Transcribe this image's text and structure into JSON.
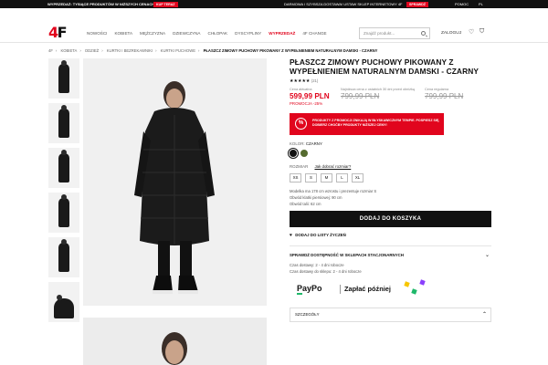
{
  "topbar": {
    "promo1": "WYPRZEDAŻ: TYSIĄCE PRODUKTÓW W NIŻSZYCH CENACH",
    "promo1_button": "KUP TERAZ",
    "promo2": "DARMOWA I SZYBSZA DOSTAWA! USTAW SKLEP INTERNETOWY 4F",
    "promo2_button": "SPRAWDŹ",
    "help": "POMOC",
    "lang": "PL"
  },
  "header": {
    "logo": "4F",
    "nav": [
      "NOWOŚCI",
      "KOBIETA",
      "MĘŻCZYZNA",
      "DZIEWCZYNA",
      "CHŁOPAK",
      "DYSCYPLINY",
      "WYPRZEDAŻ",
      "4F CHANGE"
    ],
    "search_placeholder": "Znajdź produkt...",
    "login": "ZALOGUJ"
  },
  "breadcrumb": [
    "4F",
    "KOBIETA",
    "ODZIEŻ",
    "KURTKI I BEZREKAWNIKI",
    "KURTKI PUCHOWE",
    "PŁASZCZ ZIMOWY PUCHOWY PIKOWANY Z WYPEŁNIENIEM NATURALNYM DAMSKI - CZARNY"
  ],
  "product": {
    "title": "PŁASZCZ ZIMOWY PUCHOWY PIKOWANY Z WYPEŁNIENIEM NATURALNYM DAMSKI - CZARNY",
    "stars": "★★★★★",
    "review_count": "(21)",
    "price_label": "Cena aktualna",
    "price": "599,99 PLN",
    "promo": "PROMOCJA -25%",
    "lowest_label": "Najniższa cena z ostatnich 30 dni przed obniżką",
    "lowest_price": "799,99 PLN",
    "regular_label": "Cena regularna",
    "regular_price": "799,99 PLN",
    "banner": "PRODUKTY Z PROMOCJI ZNIKAJĄ W BŁYSKAWICZNYM TEMPIE. POSPIESZ SIĘ, DOBIERZ CHOĆBY PRODUKTY NIŻSZEJ CENY!",
    "banner_icon": "%",
    "color_label": "KOLOR:",
    "color_value": "CZARNY",
    "colors": [
      "#111111",
      "#556b2f"
    ],
    "size_label": "ROZMIAR",
    "size_guide": "Jak dobrać rozmiar?",
    "sizes": [
      "XS",
      "S",
      "M",
      "L",
      "XL"
    ],
    "model_line1": "Modelka ma 178 cm wzrostu i prezentuje rozmiar S",
    "model_line2": "Obwód klatki piersiowej: 90 cm",
    "model_line3": "Obwód talii: 62 cm",
    "add_to_cart": "DODAJ DO KOSZYKA",
    "wishlist": "DODAJ DO LISTY ŻYCZEŃ",
    "availability": "SPRAWDŹ DOSTĘPNOŚĆ W SKLEPACH STACJONARNYCH",
    "delivery1": "Czas dostawy: 2 - 4 dni robocze",
    "delivery2": "Czas dostawy do sklepu: 2 - 4 dni robocze",
    "paypo": "PayPo",
    "pay_later": "Zapłać później",
    "details": "SZCZEGÓŁY"
  },
  "colors": {
    "accent": "#e1051d",
    "dark": "#111111"
  }
}
